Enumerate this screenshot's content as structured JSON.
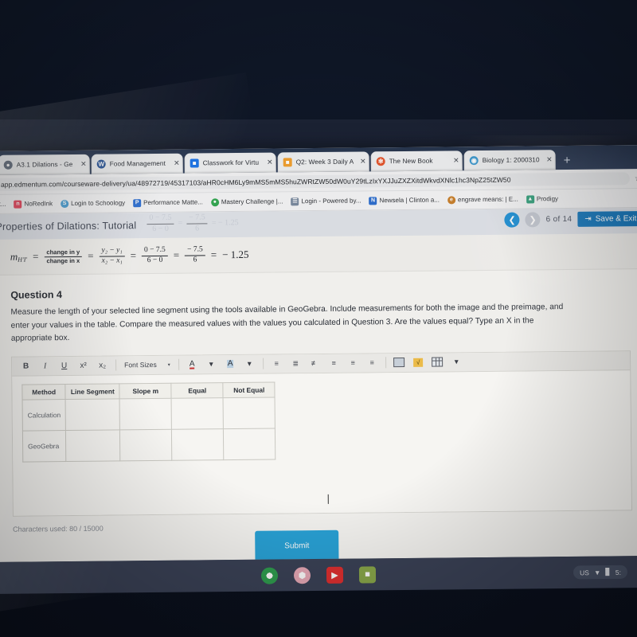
{
  "browser": {
    "tabs": [
      {
        "title": "A3.1 Dilations - Ge",
        "favicon": "globe-icon",
        "color": "#5f6b7a"
      },
      {
        "title": "Food Management",
        "favicon": "word-icon",
        "color": "#2b579a"
      },
      {
        "title": "Classwork for Virtu",
        "favicon": "classroom-icon",
        "color": "#1a73e8"
      },
      {
        "title": "Q2: Week 3 Daily A",
        "favicon": "doc-icon",
        "color": "#f0a030"
      },
      {
        "title": "The New Book",
        "favicon": "flower-icon",
        "color": "#e4572e"
      },
      {
        "title": "Biology 1: 2000310",
        "favicon": "globe-icon",
        "color": "#3d9ad1"
      }
    ],
    "tab_close_label": "✕",
    "new_tab_label": "+",
    "url": "app.edmentum.com/courseware-delivery/ua/48972719/45317103/aHR0cHM6Ly9mMS5hdZWRtZW50dW0uY29tL2xYX2xpdGdWkvdXNlci1hc3NpZ25tZW50",
    "url_display": "app.edmentum.com/courseware-delivery/ua/48972719/45317103/aHR0cHM6Ly9mMS5mMS5huZWRtZW50dW0uY29tLzIxYXJJuZXZXitdWkvdXNlc1hc3NpZ25tZW50",
    "star_icon": "☆",
    "bookmarks": [
      {
        "label": "nt...",
        "icon_color": "#ffffff",
        "icon_char": ""
      },
      {
        "label": "NoRedInk",
        "icon_color": "#e8415a",
        "icon_char": "n"
      },
      {
        "label": "Login to Schoology",
        "icon_color": "#4b9fd5",
        "icon_char": "S"
      },
      {
        "label": "Performance Matte...",
        "icon_color": "#2b6fd4",
        "icon_char": "P"
      },
      {
        "label": "Mastery Challenge |...",
        "icon_color": "#34a853",
        "icon_char": "●"
      },
      {
        "label": "Login - Powered by...",
        "icon_color": "#7a8aa0",
        "icon_char": "☰"
      },
      {
        "label": "Newsela | Clinton a...",
        "icon_color": "#2f6fd0",
        "icon_char": "N"
      },
      {
        "label": "engrave means: | E...",
        "icon_color": "#c87f2a",
        "icon_char": "e"
      },
      {
        "label": "Prodigy",
        "icon_color": "#2f9e7a",
        "icon_char": "▲"
      }
    ]
  },
  "lesson": {
    "title": "Properties of Dilations: Tutorial",
    "prev_icon": "chevron-left-icon",
    "next_icon": "chevron-right-icon",
    "page_counter": "6 of 14",
    "save_exit_label": "Save & Exit",
    "save_exit_icon": "exit-door-icon",
    "save_exit_color": "#1477bd"
  },
  "formula": {
    "lhs_var": "m",
    "lhs_sub": "H'I'",
    "eq": "=",
    "f1_num": "change in y",
    "f1_den": "change in x",
    "f2_num": "y₂ − y₁",
    "f2_den": "x₂ − x₁",
    "f3_num": "0 − 7.5",
    "f3_den": "6 − 0",
    "f4_num": "− 7.5",
    "f4_den": "6",
    "result": "− 1.25"
  },
  "question": {
    "heading": "Question 4",
    "line1": "Measure the length of your selected line segment using the tools available in GeoGebra. Include measurements for both the image and the",
    "line2": "preimage, and enter your values in the table. Compare the measured values with the values you calculated in Question 3. Are the values equal?",
    "line3": "Type an X in the appropriate box."
  },
  "editor": {
    "toolbar": {
      "bold": "B",
      "italic": "I",
      "underline": "U",
      "superscript": "x²",
      "subscript": "x₂",
      "font_sizes_label": "Font Sizes",
      "font_sizes_caret": "▾",
      "text_color": "A",
      "text_color_caret": "▾",
      "highlight_color": "A",
      "highlight_caret": "▾",
      "bullet_list": "bullet-list-icon",
      "number_list": "numbered-list-icon",
      "outdent": "outdent-icon",
      "align_left": "align-left-icon",
      "align_center": "align-center-icon",
      "align_right": "align-right-icon",
      "insert_image": "image-icon",
      "insert_equation": "equation-icon",
      "insert_table": "table-icon",
      "insert_table_caret": "▾"
    },
    "table": {
      "headers": [
        "Method",
        "Line Segment",
        "Slope m",
        "Equal",
        "Not Equal"
      ],
      "rows": [
        {
          "label": "Calculation",
          "cells": [
            "",
            "",
            "",
            ""
          ]
        },
        {
          "label": "GeoGebra",
          "cells": [
            "",
            "",
            "",
            ""
          ]
        }
      ]
    },
    "char_count": "Characters used: 80 / 15000"
  },
  "submit": {
    "label": "Submit",
    "color": "#29a3d9"
  },
  "shelf": {
    "apps": [
      {
        "name": "chrome-icon",
        "color": "#f2f2f2",
        "glyph": "●"
      },
      {
        "name": "files-icon",
        "color": "#e8a9b8",
        "glyph": "⬢"
      },
      {
        "name": "youtube-icon",
        "color": "#e02f2f",
        "glyph": "▶"
      },
      {
        "name": "contacts-icon",
        "color": "#8aa84a",
        "glyph": "■"
      }
    ],
    "tray": {
      "keyboard": "US",
      "wifi_icon": "▼",
      "battery_icon": "▊",
      "time": "5:"
    }
  }
}
